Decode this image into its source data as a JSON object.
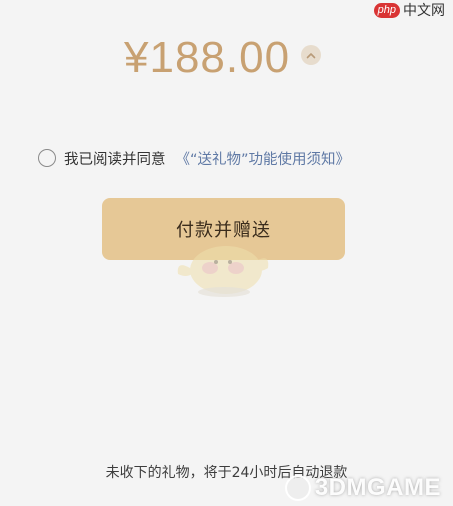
{
  "price": {
    "amount": "¥188.00"
  },
  "agreement": {
    "prefix": "我已阅读并同意",
    "link_text": "《“送礼物”功能使用须知》"
  },
  "submit_button": {
    "label": "付款并赠送"
  },
  "footer": {
    "note": "未收下的礼物，将于24小时后自动退款"
  },
  "watermarks": {
    "php_badge": "php",
    "php_site": "中文网",
    "game_site": "3DMGAME"
  },
  "colors": {
    "price": "#c8a172",
    "button": "#e6c896",
    "link": "#5f79a5",
    "background": "#f4f4f4"
  },
  "icons": {
    "expand": "chevron-up-icon",
    "checkbox": "radio-unchecked-icon"
  }
}
